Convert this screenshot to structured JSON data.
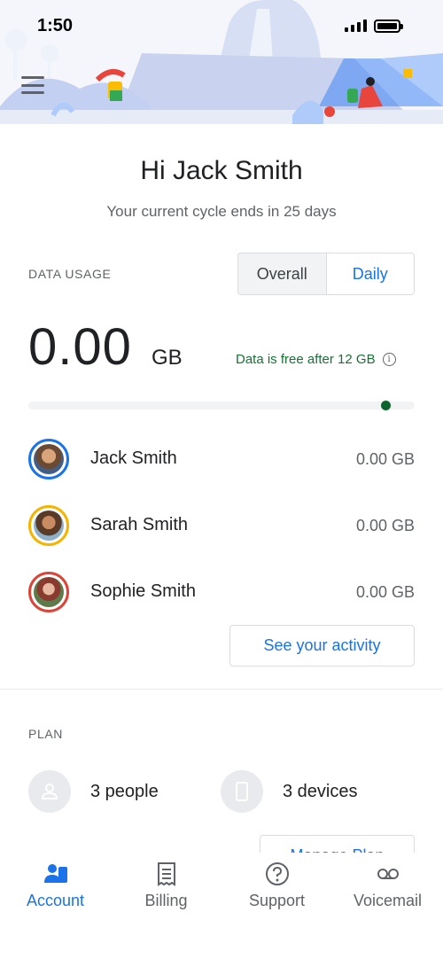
{
  "status": {
    "time": "1:50"
  },
  "greeting": {
    "title": "Hi Jack Smith",
    "cycle": "Your current cycle ends in 25 days"
  },
  "data_usage": {
    "label": "DATA USAGE",
    "toggle": [
      "Overall",
      "Daily"
    ],
    "amount": "0.00",
    "unit": "GB",
    "free_note": "Data is free after 12 GB",
    "progress": 0.0
  },
  "members": [
    {
      "name": "Jack Smith",
      "usage": "0.00 GB",
      "ring": "#1a73e8"
    },
    {
      "name": "Sarah Smith",
      "usage": "0.00 GB",
      "ring": "#f4b400"
    },
    {
      "name": "Sophie Smith",
      "usage": "0.00 GB",
      "ring": "#db4437"
    }
  ],
  "activity_button": "See your activity",
  "plan": {
    "label": "PLAN",
    "people": "3 people",
    "devices": "3 devices",
    "manage_button": "Manage Plan"
  },
  "nav": [
    {
      "label": "Account",
      "icon": "account-icon",
      "active": true
    },
    {
      "label": "Billing",
      "icon": "billing-icon",
      "active": false
    },
    {
      "label": "Support",
      "icon": "support-icon",
      "active": false
    },
    {
      "label": "Voicemail",
      "icon": "voicemail-icon",
      "active": false
    }
  ],
  "colors": {
    "accent": "#1a73e8",
    "green": "#137333"
  }
}
